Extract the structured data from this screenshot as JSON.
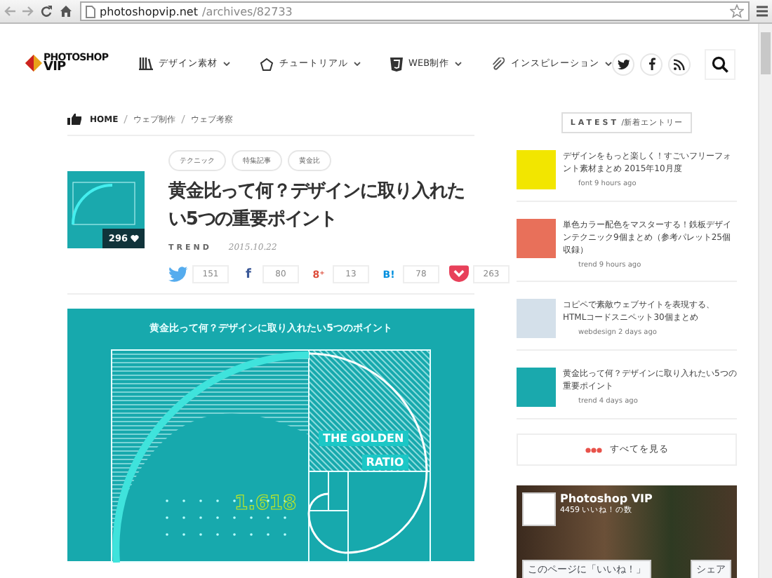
{
  "browser": {
    "url_host": "photoshopvip.net",
    "url_path": "/archives/82733"
  },
  "header": {
    "logo_top": "PHOTOSHOP",
    "logo_bottom": "VIP",
    "nav": [
      {
        "label": "デザイン素材",
        "kind": "books"
      },
      {
        "label": "チュートリアル",
        "kind": "pentagon"
      },
      {
        "label": "WEB制作",
        "kind": "html5"
      },
      {
        "label": "インスピレーション",
        "kind": "clip"
      }
    ],
    "social": [
      {
        "kind": "twitter"
      },
      {
        "kind": "facebook"
      },
      {
        "kind": "rss"
      }
    ]
  },
  "breadcrumb": [
    "HOME",
    "ウェブ制作",
    "ウェブ考察"
  ],
  "article": {
    "tags": [
      "テクニック",
      "特集記事",
      "黄金比"
    ],
    "title": "黄金比って何？デザインに取り入れたい5つの重要ポイント",
    "likes": "296",
    "category": "TREND",
    "date": "2015.10.22",
    "shares": [
      {
        "kind": "twitter",
        "count": "151"
      },
      {
        "kind": "facebook",
        "icon": "f",
        "count": "80"
      },
      {
        "kind": "gplus",
        "icon": "8⁺",
        "count": "13"
      },
      {
        "kind": "hatena",
        "icon": "B!",
        "count": "78"
      },
      {
        "kind": "pocket",
        "count": "263"
      }
    ],
    "hero": {
      "heading": "黄金比って何？デザインに取り入れたい5つのポイント",
      "badge_lines": [
        "THE GOLDEN",
        "RATIO"
      ],
      "number": "1.618"
    }
  },
  "sidebar": {
    "heading_en": "LATEST",
    "heading_ja": "/新着エントリー",
    "entries": [
      {
        "title": "デザインをもっと楽しく！すごいフリーフォント素材まとめ 2015年10月度",
        "meta": "font 9 hours ago",
        "color": "#f2e600"
      },
      {
        "title": "単色カラー配色をマスターする！鉄板デザインテクニック9個まとめ（参考パレット25個収録）",
        "meta": "trend 9 hours ago",
        "color": "#e8705a"
      },
      {
        "title": "コピペで素敵ウェブサイトを表現する、HTMLコードスニペット30個まとめ",
        "meta": "webdesign 2 days ago",
        "color": "#d4e0ea"
      },
      {
        "title": "黄金比って何？デザインに取り入れたい5つの重要ポイント",
        "meta": "trend 4 days ago",
        "color": "#1aa9ad"
      }
    ],
    "see_all": "すべてを見る",
    "fb": {
      "name": "Photoshop VIP",
      "likes": "4459 いいね！の数",
      "like_button": "このページに「いいね！」",
      "share_button": "シェア"
    }
  }
}
